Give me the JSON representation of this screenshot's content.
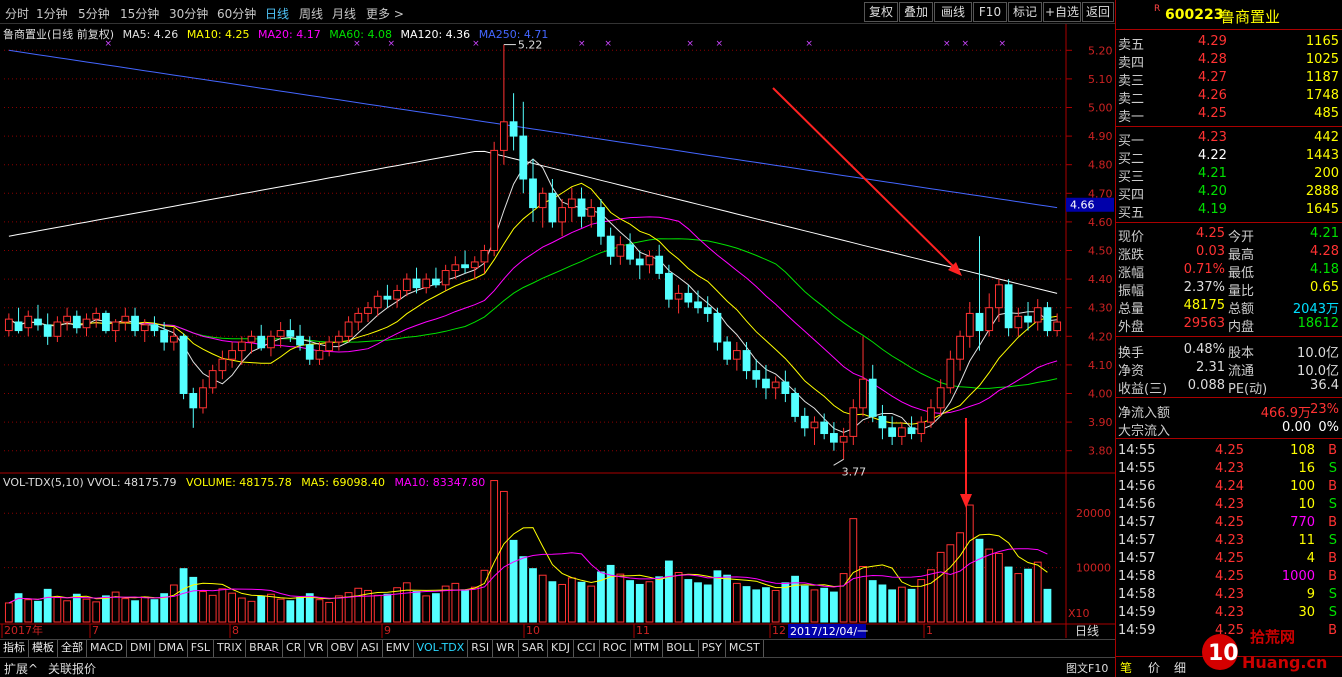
{
  "toolbar": {
    "periods": [
      "分时",
      "1分钟",
      "5分钟",
      "15分钟",
      "30分钟",
      "60分钟",
      "日线",
      "周线",
      "月线",
      "更多 >"
    ],
    "active_period": "日线",
    "buttons": [
      "复权",
      "叠加",
      "画线",
      "F10",
      "标记",
      "+自选",
      "返回"
    ]
  },
  "chart_legend": {
    "title": "鲁商置业(日线 前复权)",
    "ma5": "MA5: 4.26",
    "ma10": "MA10: 4.25",
    "ma20": "MA20: 4.17",
    "ma60": "MA60: 4.08",
    "ma120": "MA120: 4.36",
    "ma250": "MA250: 4.71"
  },
  "colors": {
    "up": "#ff3232",
    "down": "#54ffff",
    "ma5": "#e0e0e0",
    "ma10": "#ffff00",
    "ma20": "#ff00ff",
    "ma60": "#00e000",
    "ma120": "#ffffff",
    "ma250": "#4466ff",
    "grid": "#8b0000"
  },
  "price_axis": {
    "ticks": [
      "5.20",
      "5.10",
      "5.00",
      "4.90",
      "4.80",
      "4.70",
      "4.60",
      "4.50",
      "4.40",
      "4.30",
      "4.20",
      "4.10",
      "4.00",
      "3.90",
      "3.80"
    ],
    "current": "4.66",
    "high_label": "5.22",
    "low_label": "3.77"
  },
  "volume_legend": {
    "vvol": "VOL-TDX(5,10) VVOL: 48175.79",
    "volume": "VOLUME: 48175.78",
    "ma5": "MA5: 69098.40",
    "ma10": "MA10: 83347.80"
  },
  "volume_axis": {
    "ticks": [
      "20000",
      "10000"
    ],
    "unit": "X10"
  },
  "date_axis": {
    "labels": [
      "2017年",
      "7",
      "8",
      "9",
      "10",
      "11",
      "12",
      "1"
    ],
    "cursor": "2017/12/04/一",
    "right_label": "日线"
  },
  "chart_data": {
    "type": "candlestick",
    "ohlc": [
      [
        4.22,
        4.28,
        4.2,
        4.26
      ],
      [
        4.25,
        4.3,
        4.21,
        4.22
      ],
      [
        4.23,
        4.29,
        4.2,
        4.27
      ],
      [
        4.26,
        4.31,
        4.22,
        4.24
      ],
      [
        4.24,
        4.28,
        4.17,
        4.2
      ],
      [
        4.2,
        4.27,
        4.18,
        4.25
      ],
      [
        4.25,
        4.3,
        4.22,
        4.27
      ],
      [
        4.27,
        4.29,
        4.21,
        4.23
      ],
      [
        4.23,
        4.28,
        4.2,
        4.26
      ],
      [
        4.26,
        4.3,
        4.23,
        4.28
      ],
      [
        4.28,
        4.29,
        4.21,
        4.22
      ],
      [
        4.22,
        4.26,
        4.18,
        4.25
      ],
      [
        4.25,
        4.3,
        4.22,
        4.27
      ],
      [
        4.27,
        4.3,
        4.2,
        4.22
      ],
      [
        4.22,
        4.26,
        4.18,
        4.24
      ],
      [
        4.24,
        4.27,
        4.2,
        4.22
      ],
      [
        4.22,
        4.25,
        4.15,
        4.18
      ],
      [
        4.18,
        4.23,
        4.15,
        4.2
      ],
      [
        4.2,
        4.21,
        3.98,
        4.0
      ],
      [
        4.0,
        4.02,
        3.88,
        3.95
      ],
      [
        3.95,
        4.05,
        3.93,
        4.02
      ],
      [
        4.02,
        4.1,
        4.0,
        4.08
      ],
      [
        4.08,
        4.15,
        4.05,
        4.12
      ],
      [
        4.12,
        4.18,
        4.09,
        4.15
      ],
      [
        4.15,
        4.2,
        4.1,
        4.18
      ],
      [
        4.18,
        4.22,
        4.14,
        4.2
      ],
      [
        4.2,
        4.24,
        4.15,
        4.16
      ],
      [
        4.16,
        4.22,
        4.13,
        4.2
      ],
      [
        4.2,
        4.25,
        4.16,
        4.22
      ],
      [
        4.22,
        4.26,
        4.18,
        4.2
      ],
      [
        4.2,
        4.24,
        4.15,
        4.17
      ],
      [
        4.17,
        4.2,
        4.1,
        4.12
      ],
      [
        4.12,
        4.18,
        4.1,
        4.15
      ],
      [
        4.15,
        4.2,
        4.13,
        4.18
      ],
      [
        4.18,
        4.22,
        4.15,
        4.2
      ],
      [
        4.2,
        4.27,
        4.18,
        4.25
      ],
      [
        4.25,
        4.3,
        4.22,
        4.28
      ],
      [
        4.28,
        4.32,
        4.25,
        4.3
      ],
      [
        4.3,
        4.36,
        4.27,
        4.34
      ],
      [
        4.34,
        4.38,
        4.3,
        4.33
      ],
      [
        4.33,
        4.38,
        4.3,
        4.36
      ],
      [
        4.36,
        4.42,
        4.34,
        4.4
      ],
      [
        4.4,
        4.44,
        4.35,
        4.37
      ],
      [
        4.37,
        4.42,
        4.35,
        4.4
      ],
      [
        4.4,
        4.44,
        4.37,
        4.38
      ],
      [
        4.38,
        4.45,
        4.36,
        4.43
      ],
      [
        4.43,
        4.48,
        4.4,
        4.45
      ],
      [
        4.45,
        4.5,
        4.42,
        4.44
      ],
      [
        4.44,
        4.48,
        4.4,
        4.46
      ],
      [
        4.46,
        4.52,
        4.42,
        4.5
      ],
      [
        4.5,
        4.88,
        4.48,
        4.85
      ],
      [
        4.85,
        5.22,
        4.8,
        4.95
      ],
      [
        4.95,
        5.05,
        4.85,
        4.9
      ],
      [
        4.9,
        5.02,
        4.7,
        4.75
      ],
      [
        4.75,
        4.82,
        4.6,
        4.65
      ],
      [
        4.65,
        4.72,
        4.58,
        4.7
      ],
      [
        4.7,
        4.75,
        4.58,
        4.6
      ],
      [
        4.6,
        4.68,
        4.55,
        4.65
      ],
      [
        4.65,
        4.72,
        4.6,
        4.68
      ],
      [
        4.68,
        4.72,
        4.58,
        4.62
      ],
      [
        4.62,
        4.68,
        4.58,
        4.65
      ],
      [
        4.65,
        4.68,
        4.52,
        4.55
      ],
      [
        4.55,
        4.58,
        4.45,
        4.48
      ],
      [
        4.48,
        4.55,
        4.45,
        4.52
      ],
      [
        4.52,
        4.56,
        4.45,
        4.47
      ],
      [
        4.47,
        4.5,
        4.4,
        4.45
      ],
      [
        4.45,
        4.5,
        4.42,
        4.48
      ],
      [
        4.48,
        4.52,
        4.4,
        4.42
      ],
      [
        4.42,
        4.45,
        4.3,
        4.33
      ],
      [
        4.33,
        4.38,
        4.28,
        4.35
      ],
      [
        4.35,
        4.38,
        4.3,
        4.32
      ],
      [
        4.32,
        4.36,
        4.28,
        4.3
      ],
      [
        4.3,
        4.34,
        4.25,
        4.28
      ],
      [
        4.28,
        4.3,
        4.15,
        4.18
      ],
      [
        4.18,
        4.2,
        4.1,
        4.12
      ],
      [
        4.12,
        4.18,
        4.08,
        4.15
      ],
      [
        4.15,
        4.18,
        4.05,
        4.08
      ],
      [
        4.08,
        4.12,
        4.02,
        4.05
      ],
      [
        4.05,
        4.1,
        3.98,
        4.02
      ],
      [
        4.02,
        4.06,
        3.98,
        4.04
      ],
      [
        4.04,
        4.08,
        3.97,
        4.0
      ],
      [
        4.0,
        4.02,
        3.9,
        3.92
      ],
      [
        3.92,
        3.95,
        3.85,
        3.88
      ],
      [
        3.88,
        3.92,
        3.82,
        3.9
      ],
      [
        3.9,
        3.93,
        3.84,
        3.86
      ],
      [
        3.86,
        3.9,
        3.8,
        3.83
      ],
      [
        3.83,
        3.88,
        3.77,
        3.85
      ],
      [
        3.85,
        3.98,
        3.82,
        3.95
      ],
      [
        3.95,
        4.2,
        3.92,
        4.05
      ],
      [
        4.05,
        4.1,
        3.9,
        3.92
      ],
      [
        3.92,
        3.96,
        3.84,
        3.88
      ],
      [
        3.88,
        3.92,
        3.82,
        3.85
      ],
      [
        3.85,
        3.9,
        3.82,
        3.88
      ],
      [
        3.88,
        3.92,
        3.84,
        3.86
      ],
      [
        3.86,
        3.92,
        3.83,
        3.9
      ],
      [
        3.9,
        3.98,
        3.88,
        3.95
      ],
      [
        3.95,
        4.05,
        3.92,
        4.02
      ],
      [
        4.02,
        4.15,
        4.0,
        4.12
      ],
      [
        4.12,
        4.22,
        4.08,
        4.2
      ],
      [
        4.2,
        4.32,
        4.16,
        4.28
      ],
      [
        4.28,
        4.55,
        4.15,
        4.22
      ],
      [
        4.22,
        4.35,
        4.2,
        4.3
      ],
      [
        4.3,
        4.4,
        4.25,
        4.38
      ],
      [
        4.38,
        4.4,
        4.2,
        4.23
      ],
      [
        4.23,
        4.3,
        4.2,
        4.27
      ],
      [
        4.27,
        4.32,
        4.22,
        4.25
      ],
      [
        4.25,
        4.33,
        4.22,
        4.3
      ],
      [
        4.3,
        4.32,
        4.2,
        4.22
      ],
      [
        4.22,
        4.28,
        4.2,
        4.25
      ]
    ],
    "volume": [
      3500,
      5200,
      4100,
      3800,
      6000,
      4500,
      3900,
      5100,
      4200,
      3700,
      4800,
      5500,
      4300,
      3900,
      4600,
      4100,
      5200,
      6800,
      9800,
      8200,
      5600,
      4900,
      6100,
      5300,
      4400,
      3800,
      4700,
      5100,
      4200,
      3900,
      4500,
      5200,
      4100,
      3600,
      4800,
      5400,
      6200,
      5800,
      4900,
      5100,
      6300,
      7200,
      5600,
      4800,
      5200,
      6600,
      7100,
      5900,
      6400,
      9500,
      26000,
      24000,
      15000,
      12000,
      9800,
      8600,
      7400,
      6900,
      8100,
      7300,
      6600,
      9200,
      10400,
      8800,
      7600,
      6900,
      7400,
      8300,
      11200,
      9100,
      7800,
      7200,
      6800,
      9400,
      8600,
      7100,
      6500,
      5900,
      6300,
      5800,
      7200,
      8400,
      6600,
      5900,
      6200,
      5500,
      8900,
      19000,
      10200,
      7600,
      6800,
      5900,
      6400,
      6000,
      7800,
      9600,
      12800,
      14200,
      16400,
      21500,
      15200,
      13400,
      12600,
      10100,
      8900,
      9700,
      11000,
      6000
    ],
    "ylim": [
      3.75,
      5.25
    ],
    "vol_ylim": [
      0,
      25000
    ],
    "annotations": [
      "5.22",
      "3.77"
    ]
  },
  "quote": {
    "code": "600223",
    "name": "鲁商置业",
    "flag": "R",
    "asks": [
      {
        "label": "卖五",
        "price": "4.29",
        "vol": "1165"
      },
      {
        "label": "卖四",
        "price": "4.28",
        "vol": "1025"
      },
      {
        "label": "卖三",
        "price": "4.27",
        "vol": "1187"
      },
      {
        "label": "卖二",
        "price": "4.26",
        "vol": "1748"
      },
      {
        "label": "卖一",
        "price": "4.25",
        "vol": "485"
      }
    ],
    "bids": [
      {
        "label": "买一",
        "price": "4.23",
        "vol": "442"
      },
      {
        "label": "买二",
        "price": "4.22",
        "vol": "1443"
      },
      {
        "label": "买三",
        "price": "4.21",
        "vol": "200"
      },
      {
        "label": "买四",
        "price": "4.20",
        "vol": "2888"
      },
      {
        "label": "买五",
        "price": "4.19",
        "vol": "1645"
      }
    ],
    "stats": [
      {
        "l1": "现价",
        "v1": "4.25",
        "l2": "今开",
        "v2": "4.21"
      },
      {
        "l1": "涨跌",
        "v1": "0.03",
        "l2": "最高",
        "v2": "4.28"
      },
      {
        "l1": "涨幅",
        "v1": "0.71%",
        "l2": "最低",
        "v2": "4.18"
      },
      {
        "l1": "振幅",
        "v1": "2.37%",
        "l2": "量比",
        "v2": "0.65"
      },
      {
        "l1": "总量",
        "v1": "48175",
        "l2": "总额",
        "v2": "2043万"
      },
      {
        "l1": "外盘",
        "v1": "29563",
        "l2": "内盘",
        "v2": "18612"
      }
    ],
    "stats2": [
      {
        "l1": "换手",
        "v1": "0.48%",
        "l2": "股本",
        "v2": "10.0亿"
      },
      {
        "l1": "净资",
        "v1": "2.31",
        "l2": "流通",
        "v2": "10.0亿"
      },
      {
        "l1": "收益(三)",
        "v1": "0.088",
        "l2": "PE(动)",
        "v2": "36.4"
      }
    ],
    "netflow": {
      "label": "净流入额",
      "value": "466.9万",
      "pct": "23%"
    },
    "block": {
      "label": "大宗流入",
      "value": "0.00",
      "pct": "0%"
    },
    "ticks": [
      {
        "t": "14:55",
        "p": "4.25",
        "v": "108",
        "s": "B"
      },
      {
        "t": "14:55",
        "p": "4.23",
        "v": "16",
        "s": "S"
      },
      {
        "t": "14:56",
        "p": "4.24",
        "v": "100",
        "s": "B"
      },
      {
        "t": "14:56",
        "p": "4.23",
        "v": "10",
        "s": "S"
      },
      {
        "t": "14:57",
        "p": "4.25",
        "v": "770",
        "s": "B"
      },
      {
        "t": "14:57",
        "p": "4.23",
        "v": "11",
        "s": "S"
      },
      {
        "t": "14:57",
        "p": "4.25",
        "v": "4",
        "s": "B"
      },
      {
        "t": "14:58",
        "p": "4.25",
        "v": "1000",
        "s": "B"
      },
      {
        "t": "14:58",
        "p": "4.23",
        "v": "9",
        "s": "S"
      },
      {
        "t": "14:59",
        "p": "4.23",
        "v": "30",
        "s": "S"
      },
      {
        "t": "14:59",
        "p": "4.25",
        "v": "",
        "s": "B"
      }
    ],
    "tabs": [
      "笔",
      "价",
      "细"
    ]
  },
  "indicators": [
    "指标",
    "模板",
    "全部",
    "MACD",
    "DMI",
    "DMA",
    "FSL",
    "TRIX",
    "BRAR",
    "CR",
    "VR",
    "OBV",
    "ASI",
    "EMV",
    "VOL-TDX",
    "RSI",
    "WR",
    "SAR",
    "KDJ",
    "CCI",
    "ROC",
    "MTM",
    "BOLL",
    "PSY",
    "MCST"
  ],
  "active_indicator": "VOL-TDX",
  "bottom": {
    "expand": "扩展^",
    "related": "关联报价",
    "chart_f10": "图文F10"
  },
  "watermark": {
    "text": "Huang.cn",
    "text2": "拾荒网"
  }
}
